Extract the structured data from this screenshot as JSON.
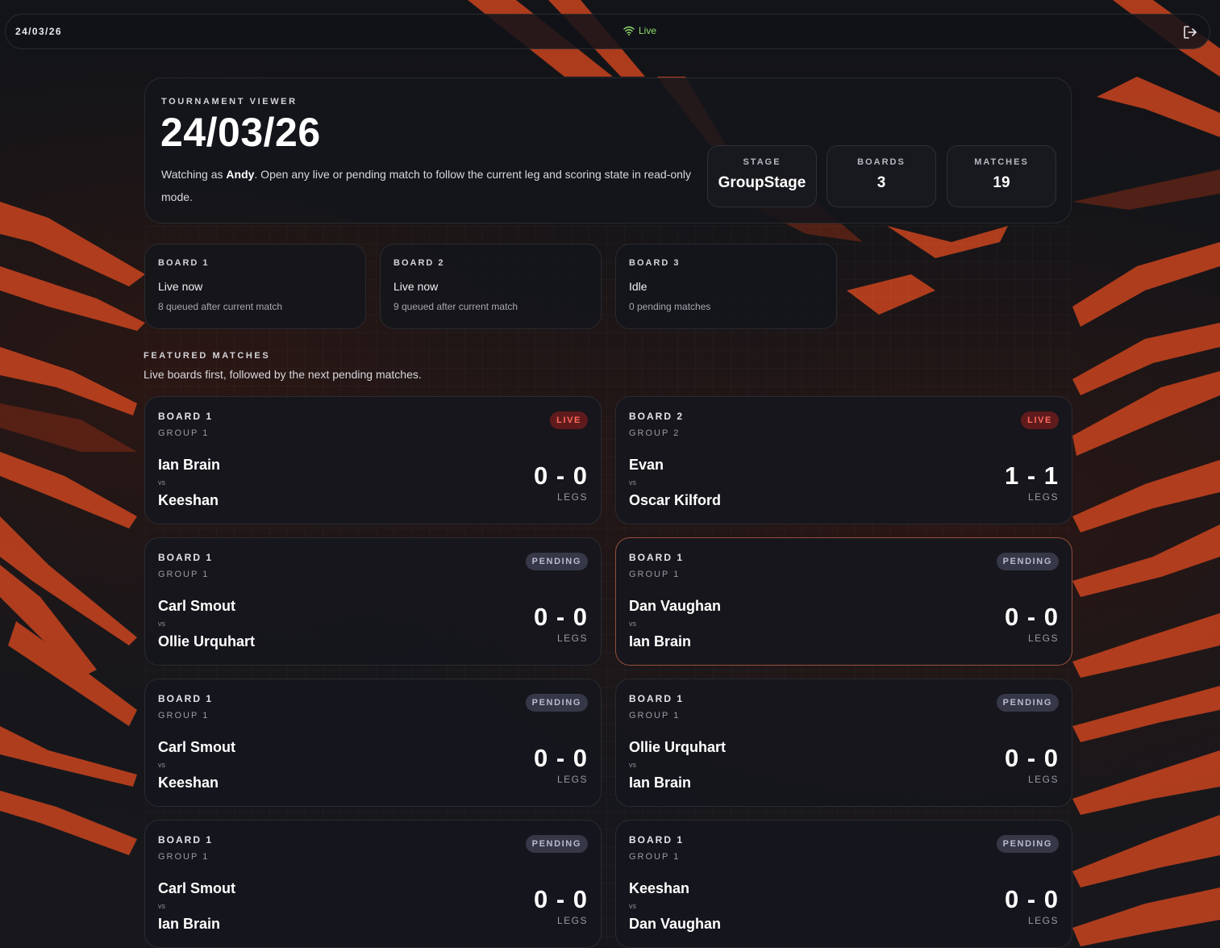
{
  "topbar": {
    "date": "24/03/26",
    "connection_label": "Live",
    "connection_color": "#8fdc6a",
    "icons": {
      "connection": "wifi-icon",
      "logout": "logout-icon"
    }
  },
  "header": {
    "eyebrow": "TOURNAMENT VIEWER",
    "title": "24/03/26",
    "desc_prefix": "Watching as ",
    "viewer_name": "Andy",
    "desc_suffix": ". Open any live or pending match to follow the current leg and scoring state in read-only mode.",
    "stats": [
      {
        "label": "STAGE",
        "value": "GroupStage"
      },
      {
        "label": "BOARDS",
        "value": "3"
      },
      {
        "label": "MATCHES",
        "value": "19"
      }
    ]
  },
  "boards": [
    {
      "label": "BOARD 1",
      "status": "Live now",
      "sub": "8 queued after current match"
    },
    {
      "label": "BOARD 2",
      "status": "Live now",
      "sub": "9 queued after current match"
    },
    {
      "label": "BOARD 3",
      "status": "Idle",
      "sub": "0 pending matches"
    }
  ],
  "featured": {
    "title": "FEATURED MATCHES",
    "subtitle": "Live boards first, followed by the next pending matches."
  },
  "matches": [
    {
      "board": "BOARD 1",
      "group": "GROUP 1",
      "badge": "LIVE",
      "player1": "Ian Brain",
      "vs": "vs",
      "player2": "Keeshan",
      "score": "0 - 0",
      "unit": "LEGS"
    },
    {
      "board": "BOARD 2",
      "group": "GROUP 2",
      "badge": "LIVE",
      "player1": "Evan",
      "vs": "vs",
      "player2": "Oscar Kilford",
      "score": "1 - 1",
      "unit": "LEGS"
    },
    {
      "board": "BOARD 1",
      "group": "GROUP 1",
      "badge": "PENDING",
      "player1": "Carl Smout",
      "vs": "vs",
      "player2": "Ollie Urquhart",
      "score": "0 - 0",
      "unit": "LEGS"
    },
    {
      "board": "BOARD 1",
      "group": "GROUP 1",
      "badge": "PENDING",
      "player1": "Dan Vaughan",
      "vs": "vs",
      "player2": "Ian Brain",
      "score": "0 - 0",
      "unit": "LEGS"
    },
    {
      "board": "BOARD 1",
      "group": "GROUP 1",
      "badge": "PENDING",
      "player1": "Carl Smout",
      "vs": "vs",
      "player2": "Keeshan",
      "score": "0 - 0",
      "unit": "LEGS"
    },
    {
      "board": "BOARD 1",
      "group": "GROUP 1",
      "badge": "PENDING",
      "player1": "Ollie Urquhart",
      "vs": "vs",
      "player2": "Ian Brain",
      "score": "0 - 0",
      "unit": "LEGS"
    },
    {
      "board": "BOARD 1",
      "group": "GROUP 1",
      "badge": "PENDING",
      "player1": "Carl Smout",
      "vs": "vs",
      "player2": "Ian Brain",
      "score": "0 - 0",
      "unit": "LEGS"
    },
    {
      "board": "BOARD 1",
      "group": "GROUP 1",
      "badge": "PENDING",
      "player1": "Keeshan",
      "vs": "vs",
      "player2": "Dan Vaughan",
      "score": "0 - 0",
      "unit": "LEGS"
    }
  ],
  "colors": {
    "accent": "#e0522a",
    "live_badge": "#ff6a5c",
    "pending_badge": "#b9bbd0"
  }
}
